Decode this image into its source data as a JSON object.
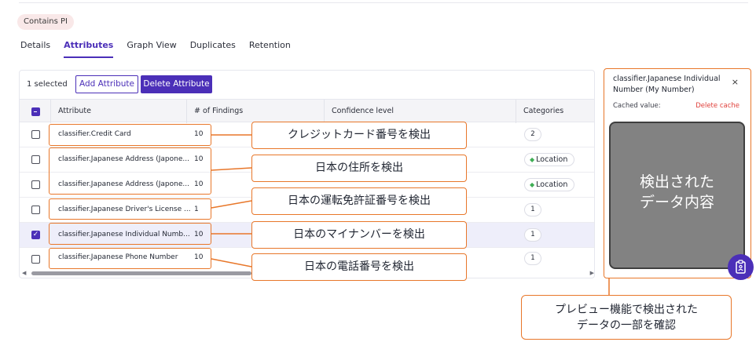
{
  "tags": {
    "contains_pi": "Contains PI"
  },
  "tabs": [
    {
      "label": "Details",
      "active": false
    },
    {
      "label": "Attributes",
      "active": true
    },
    {
      "label": "Graph View",
      "active": false
    },
    {
      "label": "Duplicates",
      "active": false
    },
    {
      "label": "Retention",
      "active": false
    }
  ],
  "toolbar": {
    "selected_count": "1 selected",
    "add_label": "Add Attribute",
    "delete_label": "Delete Attribute"
  },
  "table": {
    "headers": {
      "attribute": "Attribute",
      "findings": "# of Findings",
      "confidence": "Confidence level",
      "categories": "Categories"
    },
    "rows": [
      {
        "attribute": "classifier.Credit Card",
        "findings": "10",
        "category": "2",
        "checked": false
      },
      {
        "attribute": "classifier.Japanese Address (Japone...",
        "findings": "10",
        "category": "Location",
        "checked": false
      },
      {
        "attribute": "classifier.Japanese Address (Japone...",
        "findings": "10",
        "category": "Location",
        "checked": false
      },
      {
        "attribute": "classifier.Japanese Driver's License ...",
        "findings": "1",
        "category": "1",
        "checked": false
      },
      {
        "attribute": "classifier.Japanese Individual Numb...",
        "findings": "10",
        "category": "1",
        "checked": true
      },
      {
        "attribute": "classifier.Japanese Phone Number",
        "findings": "10",
        "category": "1",
        "checked": false
      }
    ]
  },
  "callouts": {
    "credit_card": "クレジットカード番号を検出",
    "address": "日本の住所を検出",
    "license": "日本の運転免許証番号を検出",
    "my_number": "日本のマイナンバーを検出",
    "phone": "日本の電話番号を検出",
    "preview_line1": "プレビュー機能で検出された",
    "preview_line2": "データの一部を確認"
  },
  "preview": {
    "title": "classifier.Japanese Individual Number (My Number)",
    "close": "×",
    "cached_label": "Cached value:",
    "delete_cache": "Delete cache",
    "content_line1": "検出された",
    "content_line2": "データ内容"
  },
  "colors": {
    "accent": "#4b2fb8",
    "callout": "#e8772a",
    "danger": "#e0403b",
    "location": "#3fae55"
  },
  "icons": {
    "fab": "clipboard-icon",
    "close": "close-icon",
    "location": "diamond-icon"
  }
}
